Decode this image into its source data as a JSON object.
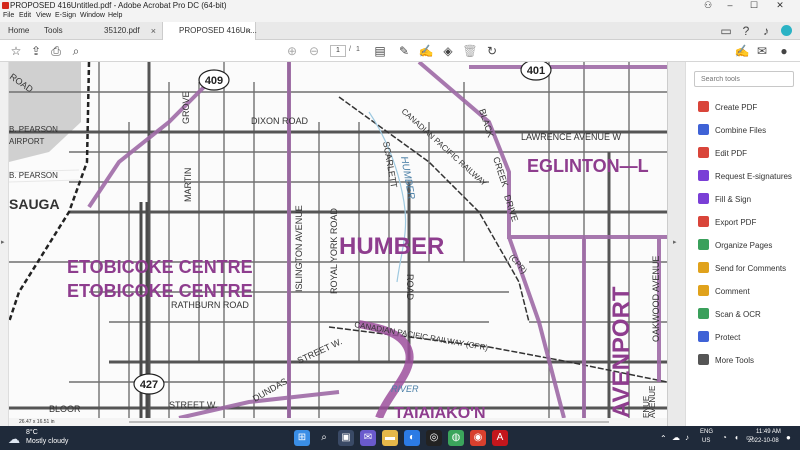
{
  "window": {
    "title": "PROPOSED 416Untitled.pdf - Adobe Acrobat Pro DC (64-bit)",
    "controls": {
      "minimize": "–",
      "maximize": "☐",
      "close": "✕"
    }
  },
  "menubar": [
    "File",
    "Edit",
    "View",
    "E-Sign",
    "Window",
    "Help"
  ],
  "tabs": {
    "home": "Home",
    "tools": "Tools",
    "doc1": "35120.pdf",
    "doc2": "PROPOSED 416Un...",
    "close_glyph": "×"
  },
  "toolbar": {
    "page_current": "1",
    "page_sep": "/",
    "page_total": "1"
  },
  "map_labels": {
    "road": "ROAD",
    "hwy409": "409",
    "hwy401": "401",
    "hwy427": "427",
    "pearson1": "B. PEARSON",
    "airport": "AIRPORT",
    "pearson2": "B. PEARSON",
    "saga": "SAUGA",
    "grove": "GROVE",
    "dixon": "DIXON   ROAD",
    "martin": "MARTIN",
    "islington": "ISLINGTON  AVENUE",
    "royalyork": "ROYAL  YORK  ROAD",
    "scarlett": "SCARLETT",
    "humber_river": "HUMBER",
    "humber": "HUMBER",
    "cpr1": "CANADIAN  PACIFIC  RAILWAY",
    "black": "BLACK",
    "creek": "CREEK",
    "drive": "DRIVE",
    "lawrence": "LAWRENCE    AVENUE  W",
    "eglinton": "EGLINTON—L",
    "etob1": "ETOBICOKE CENTRE",
    "etob2": "ETOBICOKE CENTRE",
    "rathburn": "RATHBURN  ROAD",
    "road2": "ROAD",
    "cpr_short": "(CPR)",
    "cpr2": "CANADIAN   PACIFIC   RAILWAY (CPR)",
    "davenport": "AVENPORT",
    "oakwood": "OAKWOOD  AVENUE",
    "avenue": "AVENUE",
    "dundas": "DUNDAS",
    "street_w": "STREET  W.",
    "river": "RIVER",
    "bloor": "BLOOR",
    "street_w2": "STREET  W.",
    "taiaiakon": "TAIAIAKO'N",
    "enue": "ENUE"
  },
  "tools_pane": {
    "search_placeholder": "Search tools",
    "items": [
      {
        "label": "Create PDF",
        "color": "#d9453a"
      },
      {
        "label": "Combine Files",
        "color": "#3f62d6"
      },
      {
        "label": "Edit PDF",
        "color": "#d9453a"
      },
      {
        "label": "Request E-signatures",
        "color": "#7a3fd6"
      },
      {
        "label": "Fill & Sign",
        "color": "#7a3fd6"
      },
      {
        "label": "Export PDF",
        "color": "#d9453a"
      },
      {
        "label": "Organize Pages",
        "color": "#3aa05b"
      },
      {
        "label": "Send for Comments",
        "color": "#e0a21c"
      },
      {
        "label": "Comment",
        "color": "#e0a21c"
      },
      {
        "label": "Scan & OCR",
        "color": "#3aa05b"
      },
      {
        "label": "Protect",
        "color": "#3f62d6"
      },
      {
        "label": "More Tools",
        "color": "#555555"
      }
    ]
  },
  "statusbar": {
    "dimensions": "26.47 x 16.51 in"
  },
  "taskbar": {
    "temp": "8°C",
    "weather": "Mostly cloudy",
    "lang1": "ENG",
    "lang2": "US",
    "time": "11:49 AM",
    "date": "2022-10-08"
  },
  "colors": {
    "riding_purple": "#8e3d8e",
    "boundary_purple": "#b07ab0",
    "road_gray": "#5a5a5a"
  }
}
